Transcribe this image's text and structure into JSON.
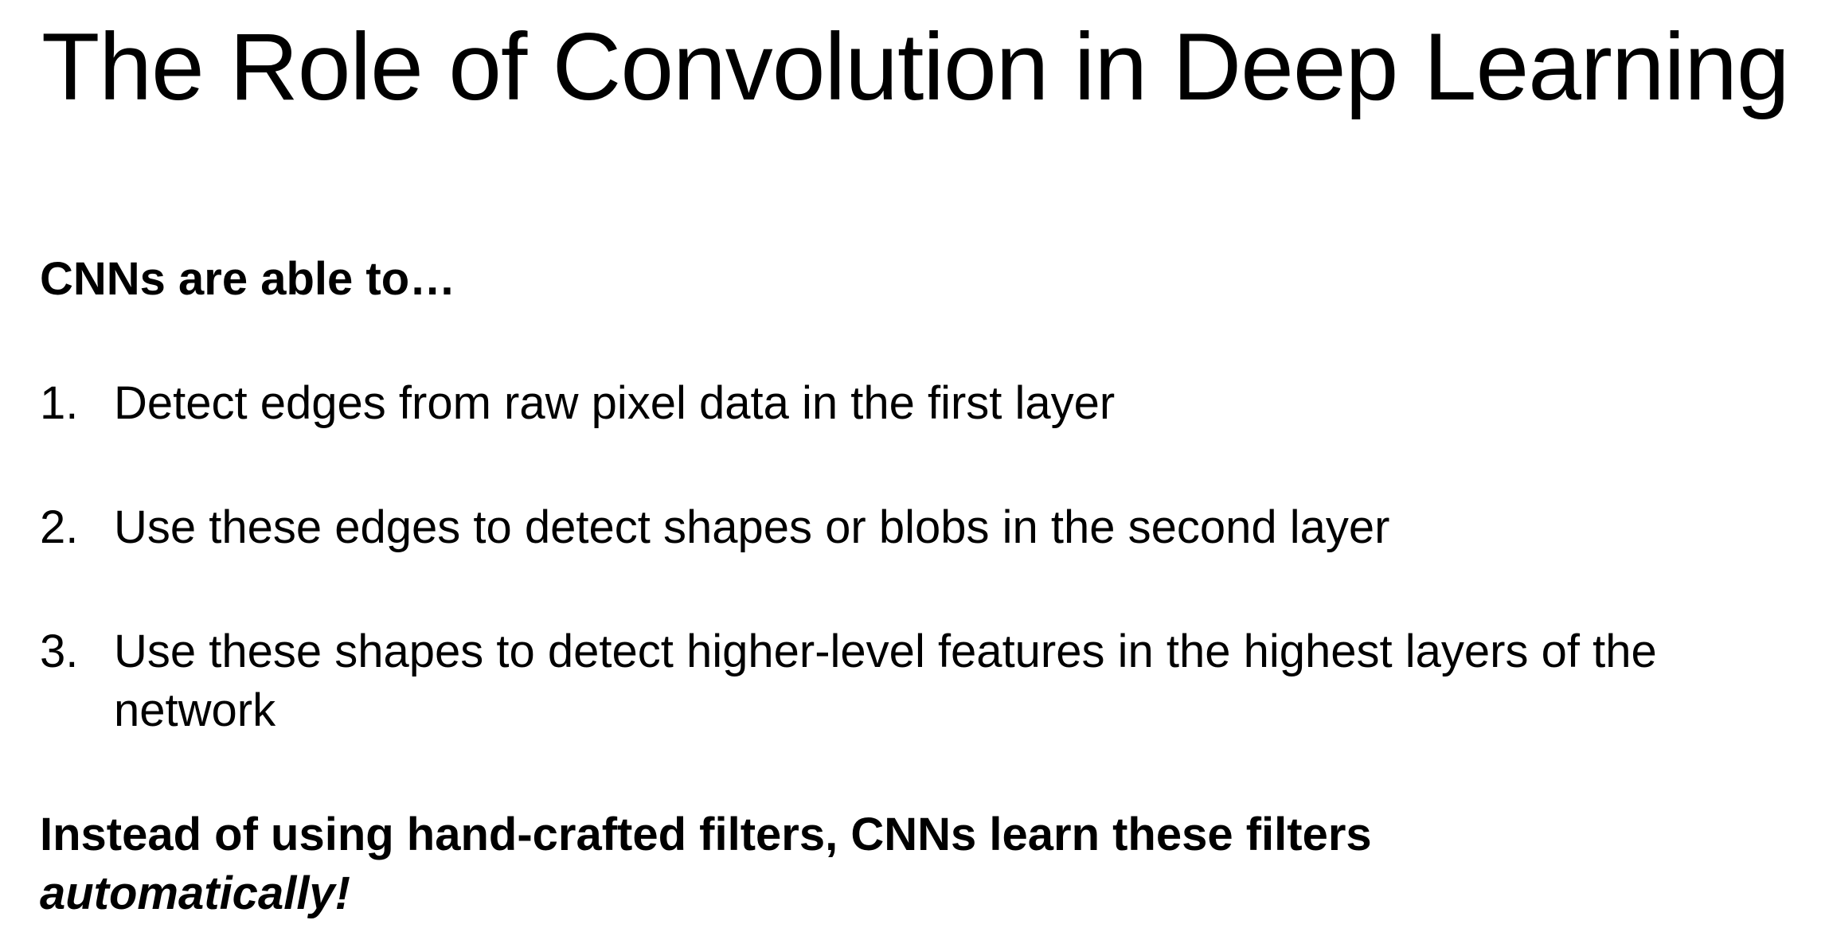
{
  "slide": {
    "title": "The Role of Convolution in Deep Learning",
    "intro": "CNNs are able to…",
    "points": [
      {
        "number": "1.",
        "text": "Detect edges from raw pixel data in the first layer"
      },
      {
        "number": "2.",
        "text": "Use these edges to detect shapes or blobs in the second layer"
      },
      {
        "number": "3.",
        "text": "Use these shapes to detect higher-level features in the highest layers of the network"
      }
    ],
    "conclusion": {
      "main": "Instead of using hand-crafted filters, CNNs learn these filters",
      "emphasis": "automatically!"
    }
  }
}
